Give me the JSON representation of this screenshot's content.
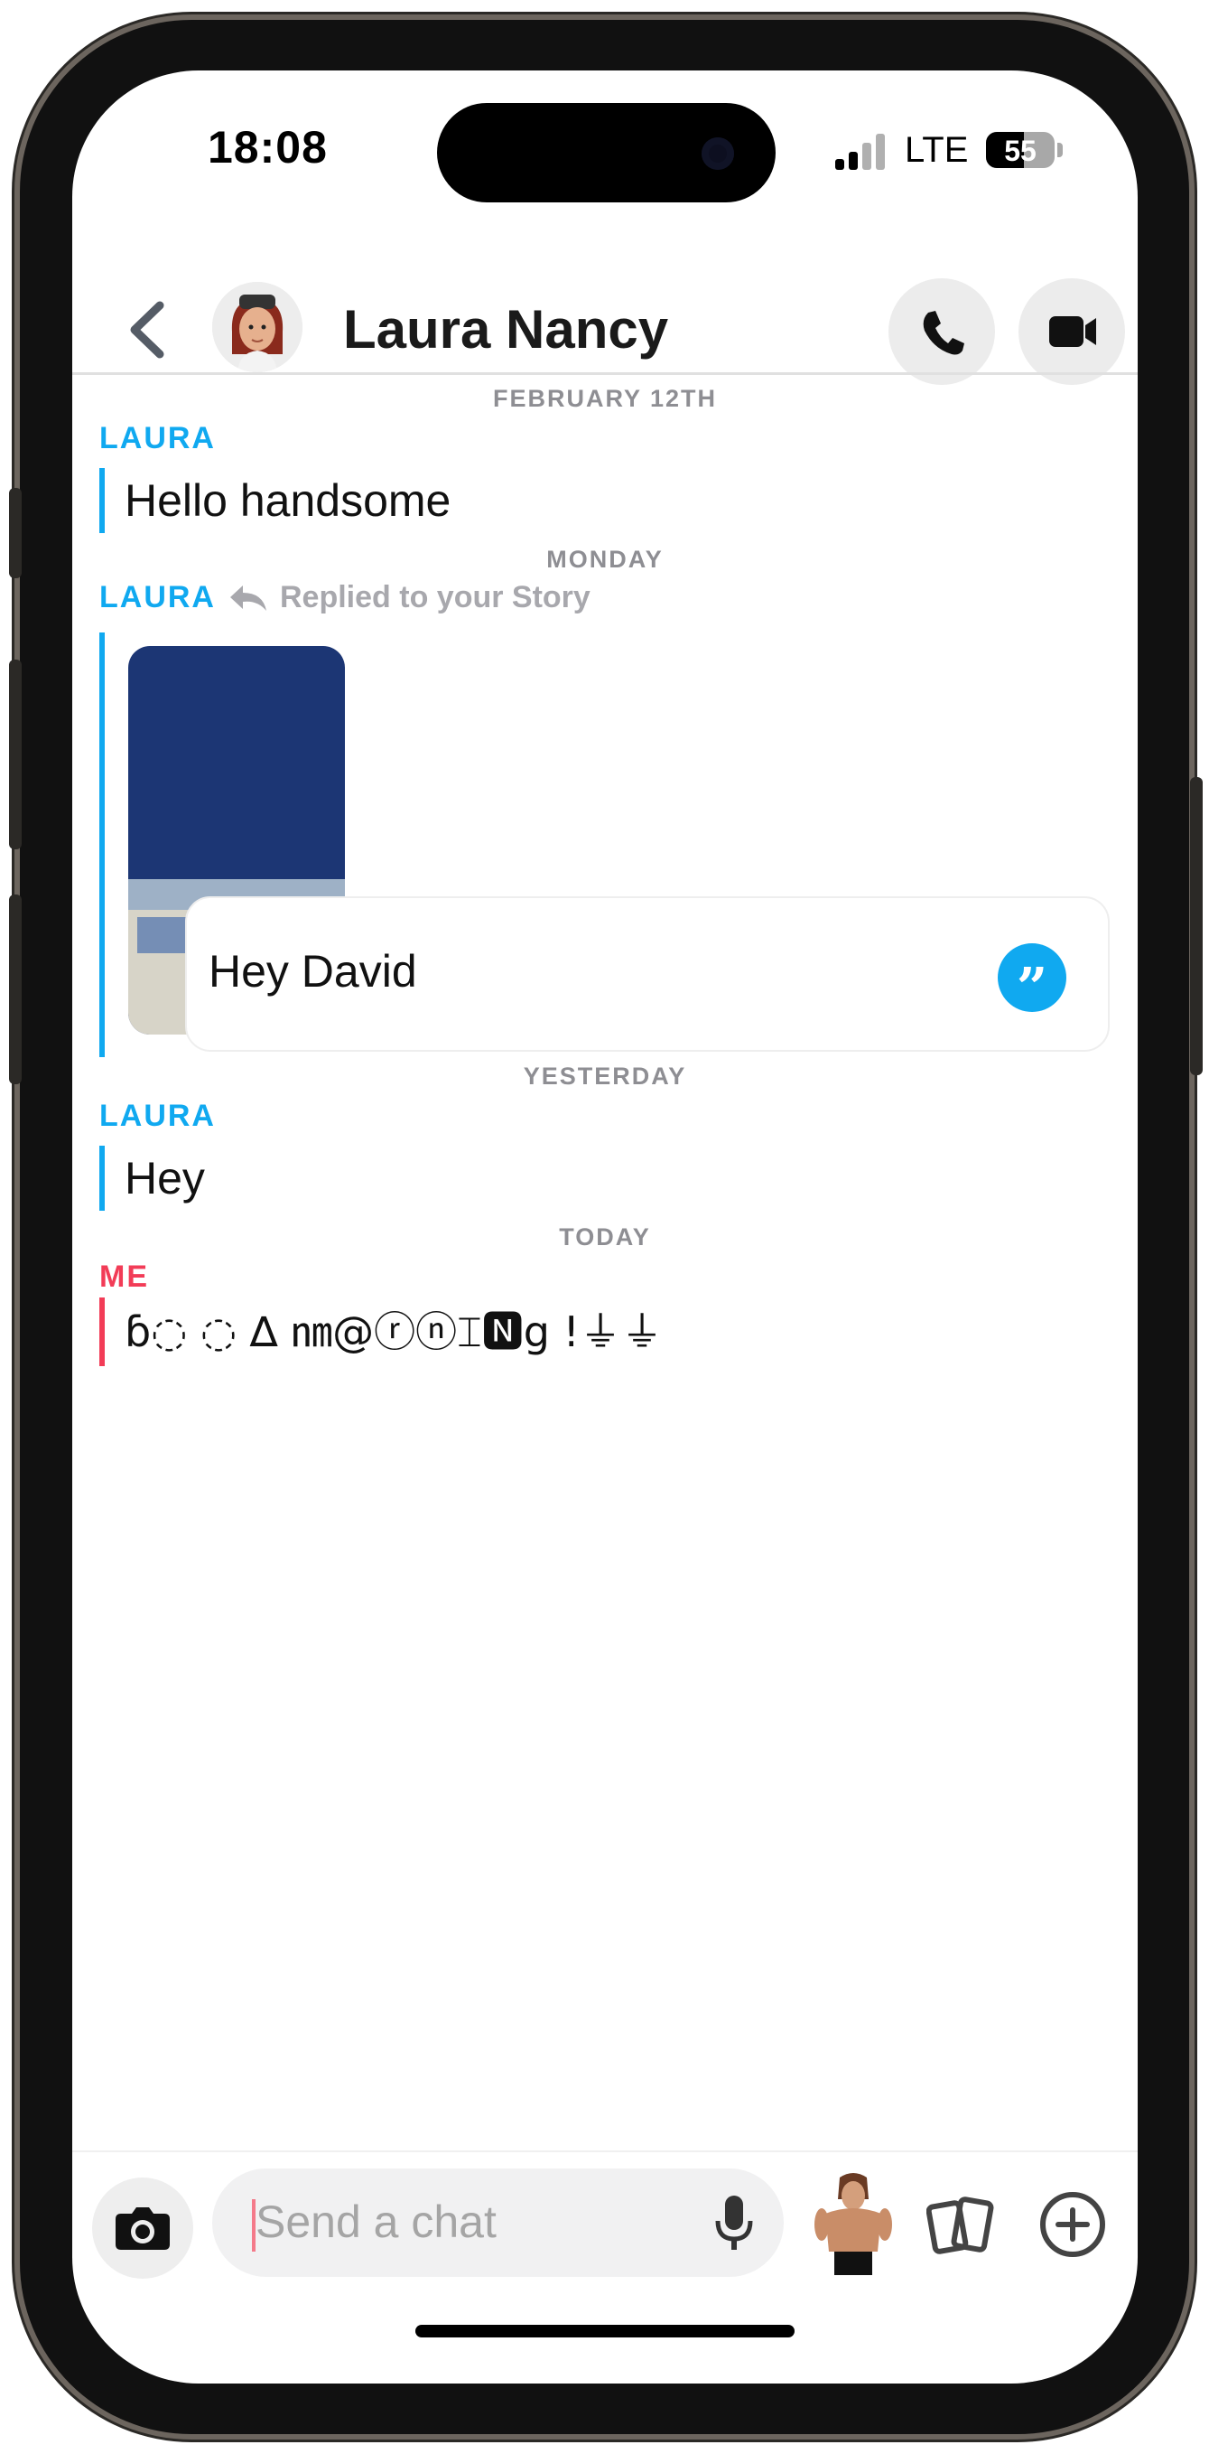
{
  "status_bar": {
    "time": "18:08",
    "network": "LTE",
    "battery_level": "55"
  },
  "header": {
    "contact_name": "Laura Nancy"
  },
  "chat": {
    "sep_1": "FEBRUARY 12TH",
    "msg_1_sender": "LAURA",
    "msg_1_text": "Hello handsome",
    "sep_2": "MONDAY",
    "msg_2_sender": "LAURA",
    "msg_2_replied": "Replied to your Story",
    "msg_2_text": "Hey David",
    "sep_3": "YESTERDAY",
    "msg_3_sender": "LAURA",
    "msg_3_text": "Hey",
    "sep_4": "TODAY",
    "msg_4_sender": "ME",
    "msg_4_text": "ɓ◌ ◌ ∆ ㎚@ⓡⓝ⌶🅽g !⏚⏚"
  },
  "composer": {
    "placeholder": "Send a chat"
  },
  "colors": {
    "friend_accent": "#10a9f0",
    "me_accent": "#f23c57"
  }
}
